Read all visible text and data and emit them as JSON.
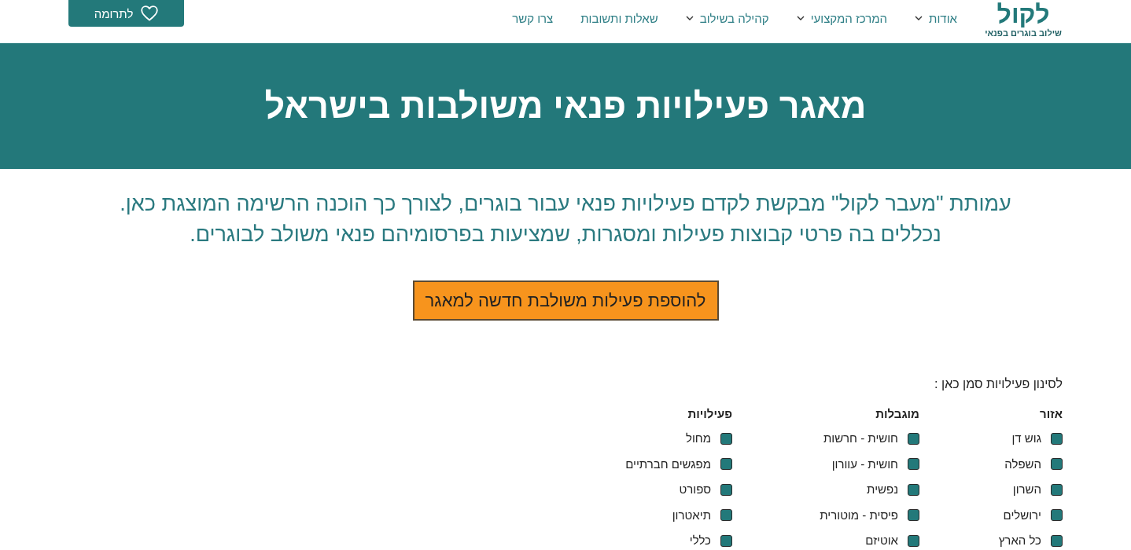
{
  "header": {
    "logo": {
      "wordmark": "לקול",
      "tagline": "שילוב בוגרים בפנאי"
    },
    "nav": [
      {
        "label": "אודות",
        "has_menu": true
      },
      {
        "label": "המרכז המקצועי",
        "has_menu": true
      },
      {
        "label": "קהילה בשילוב",
        "has_menu": true
      },
      {
        "label": "שאלות ותשובות",
        "has_menu": false
      },
      {
        "label": "צרו קשר",
        "has_menu": false
      }
    ],
    "donate_button": "לתרומה"
  },
  "banner": {
    "title": "מאגר פעילויות פנאי משולבות בישראל"
  },
  "intro": [
    "עמותת \"מעבר לקול\" מבקשת לקדם פעילויות פנאי עבור בוגרים, לצורך כך הוכנה הרשימה המוצגת כאן.",
    "נכללים בה פרטי קבוצות פעילות ומסגרות, שמציעות בפרסומיהם פנאי משולב לבוגרים."
  ],
  "add_button": "להוספת פעילות משולבת חדשה למאגר",
  "filters": {
    "label": "לסינון פעילויות סמן כאן :",
    "groups": [
      {
        "title": "אזור",
        "options": [
          {
            "label": "גוש דן",
            "checked": false
          },
          {
            "label": "השפלה",
            "checked": false
          },
          {
            "label": "השרון",
            "checked": false
          },
          {
            "label": "ירושלים",
            "checked": false
          },
          {
            "label": "כל הארץ",
            "checked": false
          }
        ]
      },
      {
        "title": "מוגבלות",
        "options": [
          {
            "label": "חושית - חרשות",
            "checked": false
          },
          {
            "label": "חושית - עוורון",
            "checked": false
          },
          {
            "label": "נפשית",
            "checked": false
          },
          {
            "label": "פיסית - מוטורית",
            "checked": false
          },
          {
            "label": "אוטיזם",
            "checked": false
          }
        ]
      },
      {
        "title": "פעילויות",
        "options": [
          {
            "label": "מחול",
            "checked": false
          },
          {
            "label": "מפגשים חברתיים",
            "checked": false
          },
          {
            "label": "ספורט",
            "checked": false
          },
          {
            "label": "תיאטרון",
            "checked": false
          },
          {
            "label": "כללי",
            "checked": false
          }
        ]
      }
    ]
  }
}
